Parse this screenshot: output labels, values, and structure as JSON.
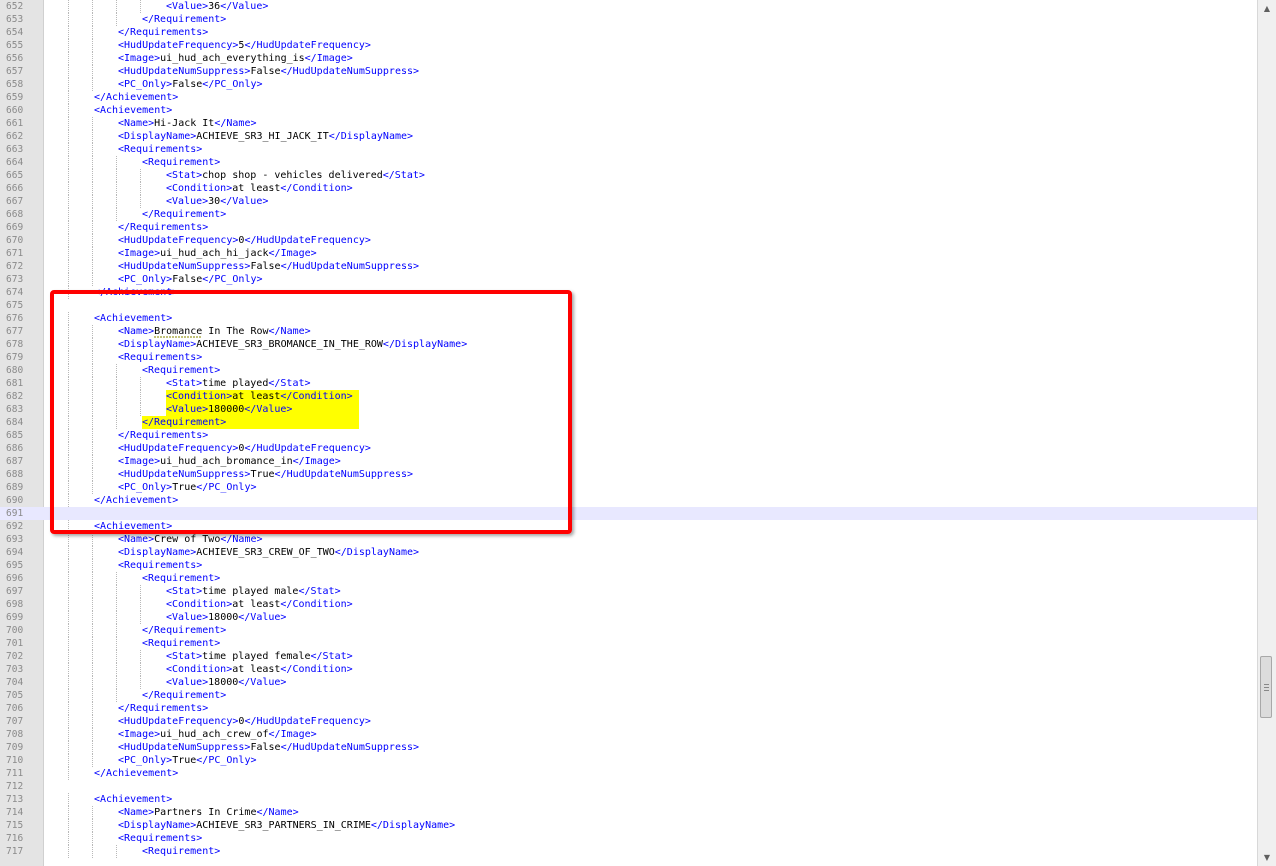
{
  "editor": {
    "lines": [
      {
        "n": "652",
        "indent": 4,
        "parts": [
          [
            "tag",
            "<Value>"
          ],
          [
            "txt",
            "36"
          ],
          [
            "tag",
            "</Value>"
          ]
        ]
      },
      {
        "n": "653",
        "indent": 3,
        "parts": [
          [
            "tag",
            "</Requirement>"
          ]
        ]
      },
      {
        "n": "654",
        "indent": 2,
        "parts": [
          [
            "tag",
            "</Requirements>"
          ]
        ]
      },
      {
        "n": "655",
        "indent": 2,
        "parts": [
          [
            "tag",
            "<HudUpdateFrequency>"
          ],
          [
            "txt",
            "5"
          ],
          [
            "tag",
            "</HudUpdateFrequency>"
          ]
        ]
      },
      {
        "n": "656",
        "indent": 2,
        "parts": [
          [
            "tag",
            "<Image>"
          ],
          [
            "txt",
            "ui_hud_ach_everything_is"
          ],
          [
            "tag",
            "</Image>"
          ]
        ]
      },
      {
        "n": "657",
        "indent": 2,
        "parts": [
          [
            "tag",
            "<HudUpdateNumSuppress>"
          ],
          [
            "txt",
            "False"
          ],
          [
            "tag",
            "</HudUpdateNumSuppress>"
          ]
        ]
      },
      {
        "n": "658",
        "indent": 2,
        "parts": [
          [
            "tag",
            "<PC_Only>"
          ],
          [
            "txt",
            "False"
          ],
          [
            "tag",
            "</PC_Only>"
          ]
        ]
      },
      {
        "n": "659",
        "indent": 1,
        "parts": [
          [
            "tag",
            "</Achievement>"
          ]
        ]
      },
      {
        "n": "660",
        "indent": 1,
        "parts": [
          [
            "tag",
            "<Achievement>"
          ]
        ]
      },
      {
        "n": "661",
        "indent": 2,
        "parts": [
          [
            "tag",
            "<Name>"
          ],
          [
            "txt",
            "Hi-Jack It"
          ],
          [
            "tag",
            "</Name>"
          ]
        ]
      },
      {
        "n": "662",
        "indent": 2,
        "parts": [
          [
            "tag",
            "<DisplayName>"
          ],
          [
            "txt",
            "ACHIEVE_SR3_HI_JACK_IT"
          ],
          [
            "tag",
            "</DisplayName>"
          ]
        ]
      },
      {
        "n": "663",
        "indent": 2,
        "parts": [
          [
            "tag",
            "<Requirements>"
          ]
        ]
      },
      {
        "n": "664",
        "indent": 3,
        "parts": [
          [
            "tag",
            "<Requirement>"
          ]
        ]
      },
      {
        "n": "665",
        "indent": 4,
        "parts": [
          [
            "tag",
            "<Stat>"
          ],
          [
            "txt",
            "chop shop - vehicles delivered"
          ],
          [
            "tag",
            "</Stat>"
          ]
        ]
      },
      {
        "n": "666",
        "indent": 4,
        "parts": [
          [
            "tag",
            "<Condition>"
          ],
          [
            "txt",
            "at least"
          ],
          [
            "tag",
            "</Condition>"
          ]
        ]
      },
      {
        "n": "667",
        "indent": 4,
        "parts": [
          [
            "tag",
            "<Value>"
          ],
          [
            "txt",
            "30"
          ],
          [
            "tag",
            "</Value>"
          ]
        ]
      },
      {
        "n": "668",
        "indent": 3,
        "parts": [
          [
            "tag",
            "</Requirement>"
          ]
        ]
      },
      {
        "n": "669",
        "indent": 2,
        "parts": [
          [
            "tag",
            "</Requirements>"
          ]
        ]
      },
      {
        "n": "670",
        "indent": 2,
        "parts": [
          [
            "tag",
            "<HudUpdateFrequency>"
          ],
          [
            "txt",
            "0"
          ],
          [
            "tag",
            "</HudUpdateFrequency>"
          ]
        ]
      },
      {
        "n": "671",
        "indent": 2,
        "parts": [
          [
            "tag",
            "<Image>"
          ],
          [
            "txt",
            "ui_hud_ach_hi_jack"
          ],
          [
            "tag",
            "</Image>"
          ]
        ]
      },
      {
        "n": "672",
        "indent": 2,
        "parts": [
          [
            "tag",
            "<HudUpdateNumSuppress>"
          ],
          [
            "txt",
            "False"
          ],
          [
            "tag",
            "</HudUpdateNumSuppress>"
          ]
        ]
      },
      {
        "n": "673",
        "indent": 2,
        "parts": [
          [
            "tag",
            "<PC_Only>"
          ],
          [
            "txt",
            "False"
          ],
          [
            "tag",
            "</PC_Only>"
          ]
        ]
      },
      {
        "n": "674",
        "indent": 1,
        "parts": [
          [
            "tag",
            "</Achievement>"
          ]
        ]
      },
      {
        "n": "675",
        "indent": 0,
        "parts": []
      },
      {
        "n": "676",
        "indent": 1,
        "parts": [
          [
            "tag",
            "<Achievement>"
          ]
        ]
      },
      {
        "n": "677",
        "indent": 2,
        "parts": [
          [
            "tag",
            "<Name>"
          ],
          [
            "txt",
            "Bromance In The Row"
          ],
          [
            "tag",
            "</Name>"
          ]
        ]
      },
      {
        "n": "678",
        "indent": 2,
        "parts": [
          [
            "tag",
            "<DisplayName>"
          ],
          [
            "txt",
            "ACHIEVE_SR3_BROMANCE_IN_THE_ROW"
          ],
          [
            "tag",
            "</DisplayName>"
          ]
        ]
      },
      {
        "n": "679",
        "indent": 2,
        "parts": [
          [
            "tag",
            "<Requirements>"
          ]
        ]
      },
      {
        "n": "680",
        "indent": 3,
        "parts": [
          [
            "tag",
            "<Requirement>"
          ]
        ]
      },
      {
        "n": "681",
        "indent": 4,
        "parts": [
          [
            "tag",
            "<Stat>"
          ],
          [
            "txt",
            "time played"
          ],
          [
            "tag",
            "</Stat>"
          ]
        ]
      },
      {
        "n": "682",
        "indent": 4,
        "hl": true,
        "parts": [
          [
            "tag",
            "<Condition>"
          ],
          [
            "txt",
            "at least"
          ],
          [
            "tag",
            "</Condition>"
          ]
        ]
      },
      {
        "n": "683",
        "indent": 4,
        "hl": true,
        "parts": [
          [
            "tag",
            "<Value>"
          ],
          [
            "txt",
            "180000"
          ],
          [
            "tag",
            "</Value>"
          ]
        ]
      },
      {
        "n": "684",
        "indent": 3,
        "hl": true,
        "parts": [
          [
            "tag",
            "</Requirement>"
          ]
        ]
      },
      {
        "n": "685",
        "indent": 2,
        "parts": [
          [
            "tag",
            "</Requirements>"
          ]
        ]
      },
      {
        "n": "686",
        "indent": 2,
        "parts": [
          [
            "tag",
            "<HudUpdateFrequency>"
          ],
          [
            "txt",
            "0"
          ],
          [
            "tag",
            "</HudUpdateFrequency>"
          ]
        ]
      },
      {
        "n": "687",
        "indent": 2,
        "parts": [
          [
            "tag",
            "<Image>"
          ],
          [
            "txt",
            "ui_hud_ach_bromance_in"
          ],
          [
            "tag",
            "</Image>"
          ]
        ]
      },
      {
        "n": "688",
        "indent": 2,
        "parts": [
          [
            "tag",
            "<HudUpdateNumSuppress>"
          ],
          [
            "txt",
            "True"
          ],
          [
            "tag",
            "</HudUpdateNumSuppress>"
          ]
        ]
      },
      {
        "n": "689",
        "indent": 2,
        "parts": [
          [
            "tag",
            "<PC_Only>"
          ],
          [
            "txt",
            "True"
          ],
          [
            "tag",
            "</PC_Only>"
          ]
        ]
      },
      {
        "n": "690",
        "indent": 1,
        "parts": [
          [
            "tag",
            "</Achievement>"
          ]
        ]
      },
      {
        "n": "691",
        "indent": 0,
        "current": true,
        "parts": []
      },
      {
        "n": "692",
        "indent": 1,
        "parts": [
          [
            "tag",
            "<Achievement>"
          ]
        ]
      },
      {
        "n": "693",
        "indent": 2,
        "parts": [
          [
            "tag",
            "<Name>"
          ],
          [
            "txt",
            "Crew of Two"
          ],
          [
            "tag",
            "</Name>"
          ]
        ]
      },
      {
        "n": "694",
        "indent": 2,
        "parts": [
          [
            "tag",
            "<DisplayName>"
          ],
          [
            "txt",
            "ACHIEVE_SR3_CREW_OF_TWO"
          ],
          [
            "tag",
            "</DisplayName>"
          ]
        ]
      },
      {
        "n": "695",
        "indent": 2,
        "parts": [
          [
            "tag",
            "<Requirements>"
          ]
        ]
      },
      {
        "n": "696",
        "indent": 3,
        "parts": [
          [
            "tag",
            "<Requirement>"
          ]
        ]
      },
      {
        "n": "697",
        "indent": 4,
        "parts": [
          [
            "tag",
            "<Stat>"
          ],
          [
            "txt",
            "time played male"
          ],
          [
            "tag",
            "</Stat>"
          ]
        ]
      },
      {
        "n": "698",
        "indent": 4,
        "parts": [
          [
            "tag",
            "<Condition>"
          ],
          [
            "txt",
            "at least"
          ],
          [
            "tag",
            "</Condition>"
          ]
        ]
      },
      {
        "n": "699",
        "indent": 4,
        "parts": [
          [
            "tag",
            "<Value>"
          ],
          [
            "txt",
            "18000"
          ],
          [
            "tag",
            "</Value>"
          ]
        ]
      },
      {
        "n": "700",
        "indent": 3,
        "parts": [
          [
            "tag",
            "</Requirement>"
          ]
        ]
      },
      {
        "n": "701",
        "indent": 3,
        "parts": [
          [
            "tag",
            "<Requirement>"
          ]
        ]
      },
      {
        "n": "702",
        "indent": 4,
        "parts": [
          [
            "tag",
            "<Stat>"
          ],
          [
            "txt",
            "time played female"
          ],
          [
            "tag",
            "</Stat>"
          ]
        ]
      },
      {
        "n": "703",
        "indent": 4,
        "parts": [
          [
            "tag",
            "<Condition>"
          ],
          [
            "txt",
            "at least"
          ],
          [
            "tag",
            "</Condition>"
          ]
        ]
      },
      {
        "n": "704",
        "indent": 4,
        "parts": [
          [
            "tag",
            "<Value>"
          ],
          [
            "txt",
            "18000"
          ],
          [
            "tag",
            "</Value>"
          ]
        ]
      },
      {
        "n": "705",
        "indent": 3,
        "parts": [
          [
            "tag",
            "</Requirement>"
          ]
        ]
      },
      {
        "n": "706",
        "indent": 2,
        "parts": [
          [
            "tag",
            "</Requirements>"
          ]
        ]
      },
      {
        "n": "707",
        "indent": 2,
        "parts": [
          [
            "tag",
            "<HudUpdateFrequency>"
          ],
          [
            "txt",
            "0"
          ],
          [
            "tag",
            "</HudUpdateFrequency>"
          ]
        ]
      },
      {
        "n": "708",
        "indent": 2,
        "parts": [
          [
            "tag",
            "<Image>"
          ],
          [
            "txt",
            "ui_hud_ach_crew_of"
          ],
          [
            "tag",
            "</Image>"
          ]
        ]
      },
      {
        "n": "709",
        "indent": 2,
        "parts": [
          [
            "tag",
            "<HudUpdateNumSuppress>"
          ],
          [
            "txt",
            "False"
          ],
          [
            "tag",
            "</HudUpdateNumSuppress>"
          ]
        ]
      },
      {
        "n": "710",
        "indent": 2,
        "parts": [
          [
            "tag",
            "<PC_Only>"
          ],
          [
            "txt",
            "True"
          ],
          [
            "tag",
            "</PC_Only>"
          ]
        ]
      },
      {
        "n": "711",
        "indent": 1,
        "parts": [
          [
            "tag",
            "</Achievement>"
          ]
        ]
      },
      {
        "n": "712",
        "indent": 0,
        "parts": []
      },
      {
        "n": "713",
        "indent": 1,
        "parts": [
          [
            "tag",
            "<Achievement>"
          ]
        ]
      },
      {
        "n": "714",
        "indent": 2,
        "parts": [
          [
            "tag",
            "<Name>"
          ],
          [
            "txt",
            "Partners In Crime"
          ],
          [
            "tag",
            "</Name>"
          ]
        ]
      },
      {
        "n": "715",
        "indent": 2,
        "parts": [
          [
            "tag",
            "<DisplayName>"
          ],
          [
            "txt",
            "ACHIEVE_SR3_PARTNERS_IN_CRIME"
          ],
          [
            "tag",
            "</DisplayName>"
          ]
        ]
      },
      {
        "n": "716",
        "indent": 2,
        "parts": [
          [
            "tag",
            "<Requirements>"
          ]
        ]
      },
      {
        "n": "717",
        "indent": 3,
        "parts": [
          [
            "tag",
            "<Requirement>"
          ]
        ]
      }
    ]
  },
  "colors": {
    "tag": "#0000ff",
    "text": "#000000",
    "highlight": "#ffff00",
    "annotation": "#ff0000",
    "current_line": "#e8e8ff"
  },
  "scrollbar": {
    "up_icon": "scroll-up-arrow-icon",
    "down_icon": "scroll-down-arrow-icon"
  }
}
